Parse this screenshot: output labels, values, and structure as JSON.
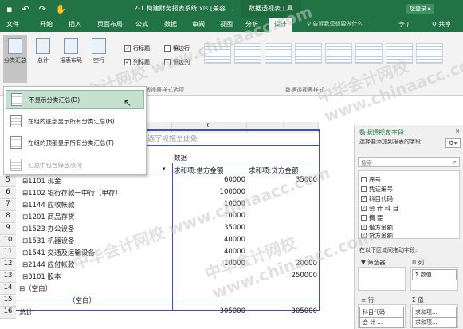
{
  "titlebar": {
    "title": "2-1 构建财务报表系统.xls [兼容...",
    "context": "数据透视表工具",
    "signin": "您登录 ▸"
  },
  "tabs": {
    "items": [
      "文件",
      "开始",
      "插入",
      "页面布局",
      "公式",
      "数据",
      "审阅",
      "视图",
      "分析",
      "设计"
    ],
    "tellme": "♀ 告诉我您想要做什么...",
    "user": "李 广",
    "share": "♀ 共享"
  },
  "ribbon": {
    "btn_subtotals": "分类汇总",
    "btn_grandtotals": "总计",
    "btn_layout": "报表布局",
    "btn_blank": "空行",
    "chk_rowheaders": "行标题",
    "chk_bandedrows": "镶边行",
    "chk_colheaders": "列标题",
    "chk_bandedcols": "镶边列",
    "group_options": "数据透视表样式选项",
    "group_styles": "数据透视表样式"
  },
  "menu": {
    "items": [
      "不显示分类汇总(D)",
      "在组的底部显示所有分类汇总(B)",
      "在组的顶部显示所有分类汇总(T)",
      "汇总中包含筛选项(I)"
    ]
  },
  "sheet": {
    "col_c": "C",
    "col_d": "D",
    "drop_hint": "筛选字段拖至此处",
    "data_label": "数据",
    "sum_debit": "求和项:借方金额",
    "sum_credit": "求和项:贷方金额",
    "rows": [
      {
        "n": "5",
        "b": "⊟1101 现金",
        "c": "60000",
        "d": "35000"
      },
      {
        "n": "6",
        "b": "⊟1102 银行存款一中行（甲存）",
        "c": "100000",
        "d": ""
      },
      {
        "n": "7",
        "b": "⊟1144 应收帐款",
        "c": "10000",
        "d": ""
      },
      {
        "n": "8",
        "b": "⊟1201 商品存货",
        "c": "10000",
        "d": ""
      },
      {
        "n": "9",
        "b": "⊟1523 办公设备",
        "c": "35000",
        "d": ""
      },
      {
        "n": "10",
        "b": "⊟1531 机器设备",
        "c": "40000",
        "d": ""
      },
      {
        "n": "11",
        "b": "⊟1541 交通及运输设备",
        "c": "40000",
        "d": ""
      },
      {
        "n": "12",
        "b": "⊟2144 应付帐款",
        "c": "10000",
        "d": "20000"
      },
      {
        "n": "13",
        "b": "⊟3101 股本",
        "c": "",
        "d": "250000"
      },
      {
        "n": "14",
        "b": "⊟（空白）",
        "c": "",
        "d": ""
      },
      {
        "n": "15",
        "b": "（空白）",
        "c": "",
        "d": ""
      },
      {
        "n": "16",
        "b": "总计",
        "c": "305000",
        "d": "305000"
      }
    ]
  },
  "panel": {
    "title": "数据透视表字段",
    "subtitle": "选择要添加到报表的字段:",
    "search": "搜索",
    "fields": [
      {
        "label": "序号",
        "checked": ""
      },
      {
        "label": "凭证编号",
        "checked": ""
      },
      {
        "label": "科目代码",
        "checked": "✓"
      },
      {
        "label": "会 计 科 目",
        "checked": "✓"
      },
      {
        "label": "摘 要",
        "checked": ""
      },
      {
        "label": "借方金额",
        "checked": "✓"
      },
      {
        "label": "贷方金额",
        "checked": "✓"
      }
    ],
    "drag_hint": "在以下区域间拖动字段:",
    "filter_label": "▼ 筛选器",
    "columns_label": "Ⅲ 列",
    "columns_value": "Σ 数值",
    "rows_label": "≡ 行",
    "values_label": "Σ 值",
    "rows_items": [
      "科目代码",
      "会 计 ..."
    ],
    "values_items": [
      "求和项...",
      "求和项..."
    ]
  },
  "watermark": "中华会计网校 www.chinaacc.com"
}
